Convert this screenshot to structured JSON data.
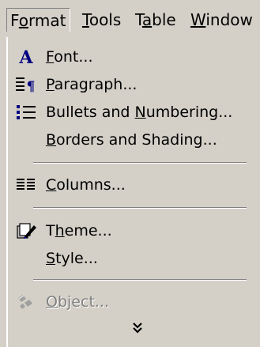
{
  "menubar": {
    "items": [
      {
        "pre": "F",
        "ul": "o",
        "post": "rmat"
      },
      {
        "pre": "",
        "ul": "T",
        "post": "ools"
      },
      {
        "pre": "T",
        "ul": "a",
        "post": "ble"
      },
      {
        "pre": "",
        "ul": "W",
        "post": "indow"
      }
    ]
  },
  "menu": {
    "items": [
      {
        "pre": "",
        "ul": "F",
        "post": "ont...",
        "icon": "font-icon",
        "enabled": true
      },
      {
        "pre": "",
        "ul": "P",
        "post": "aragraph...",
        "icon": "paragraph-icon",
        "enabled": true
      },
      {
        "pre": "Bullets and ",
        "ul": "N",
        "post": "umbering...",
        "icon": "bullets-icon",
        "enabled": true
      },
      {
        "pre": "",
        "ul": "B",
        "post": "orders and Shading...",
        "icon": "",
        "enabled": true
      },
      {
        "pre": "",
        "ul": "C",
        "post": "olumns...",
        "icon": "columns-icon",
        "enabled": true
      },
      {
        "pre": "T",
        "ul": "h",
        "post": "eme...",
        "icon": "theme-icon",
        "enabled": true
      },
      {
        "pre": "",
        "ul": "S",
        "post": "tyle...",
        "icon": "",
        "enabled": true
      },
      {
        "pre": "",
        "ul": "O",
        "post": "bject...",
        "icon": "object-icon",
        "enabled": false
      }
    ],
    "expand_icon": "double-chevron-down-icon"
  },
  "colors": {
    "menu_bg": "#d4d0c8",
    "accent_blue": "#000080",
    "disabled_text": "#808080",
    "separator_dark": "#808080",
    "separator_light": "#ffffff"
  }
}
